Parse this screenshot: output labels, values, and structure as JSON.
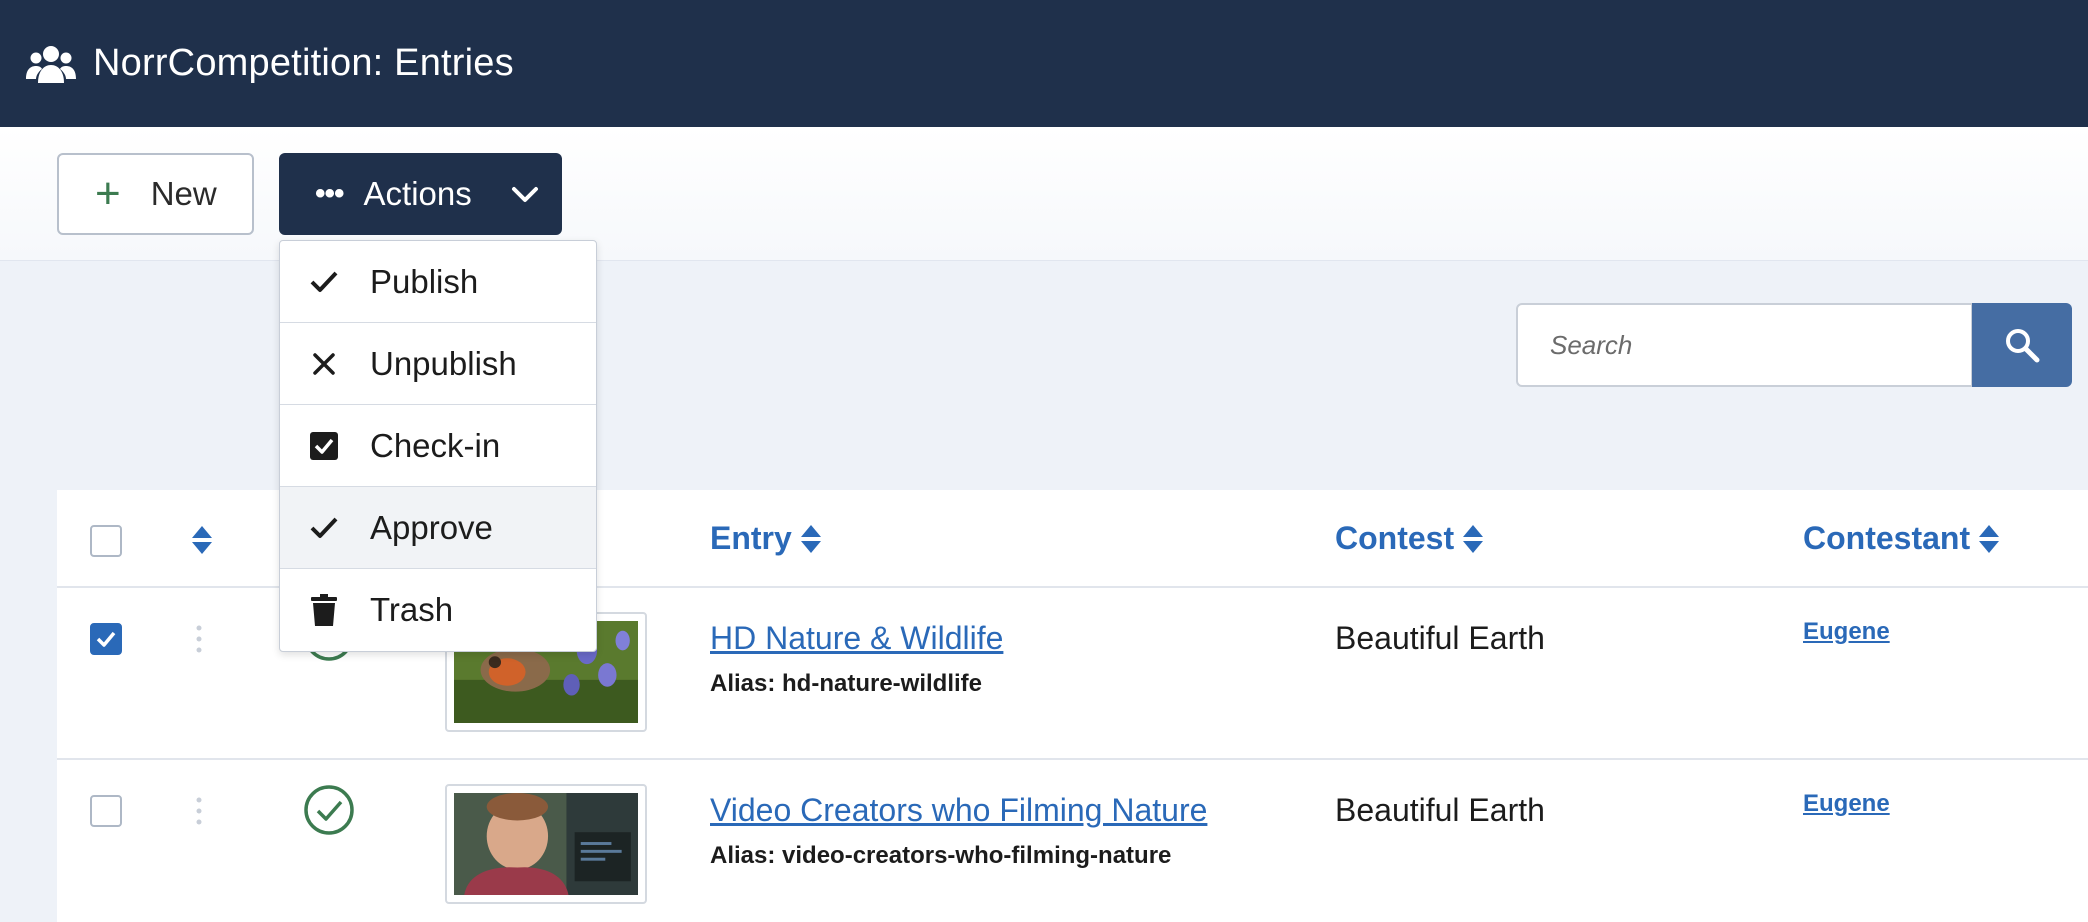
{
  "header": {
    "title": "NorrCompetition: Entries",
    "icon": "users-icon",
    "bg": "#1f304b"
  },
  "toolbar": {
    "new_label": "New",
    "actions_label": "Actions"
  },
  "actions_menu": {
    "items": [
      {
        "label": "Publish",
        "icon": "check-icon"
      },
      {
        "label": "Unpublish",
        "icon": "close-icon"
      },
      {
        "label": "Check-in",
        "icon": "checkbox-checked-icon"
      },
      {
        "label": "Approve",
        "icon": "check-icon"
      },
      {
        "label": "Trash",
        "icon": "trash-icon"
      }
    ]
  },
  "search": {
    "placeholder": "Search"
  },
  "table": {
    "columns": [
      "Entry",
      "Contest",
      "Contestant"
    ],
    "rows": [
      {
        "selected": true,
        "title": "HD Nature & Wildlife",
        "alias": "Alias: hd-nature-wildlife",
        "contest": "Beautiful Earth",
        "contestant": "Eugene",
        "status": "published"
      },
      {
        "selected": false,
        "title": "Video Creators who Filming Nature",
        "alias": "Alias: video-creators-who-filming-nature",
        "contest": "Beautiful Earth",
        "contestant": "Eugene",
        "status": "published"
      }
    ]
  },
  "colors": {
    "accent": "#2a69b8",
    "header": "#1f304b",
    "search_button": "#456da3",
    "status_green": "#3c7b50"
  }
}
